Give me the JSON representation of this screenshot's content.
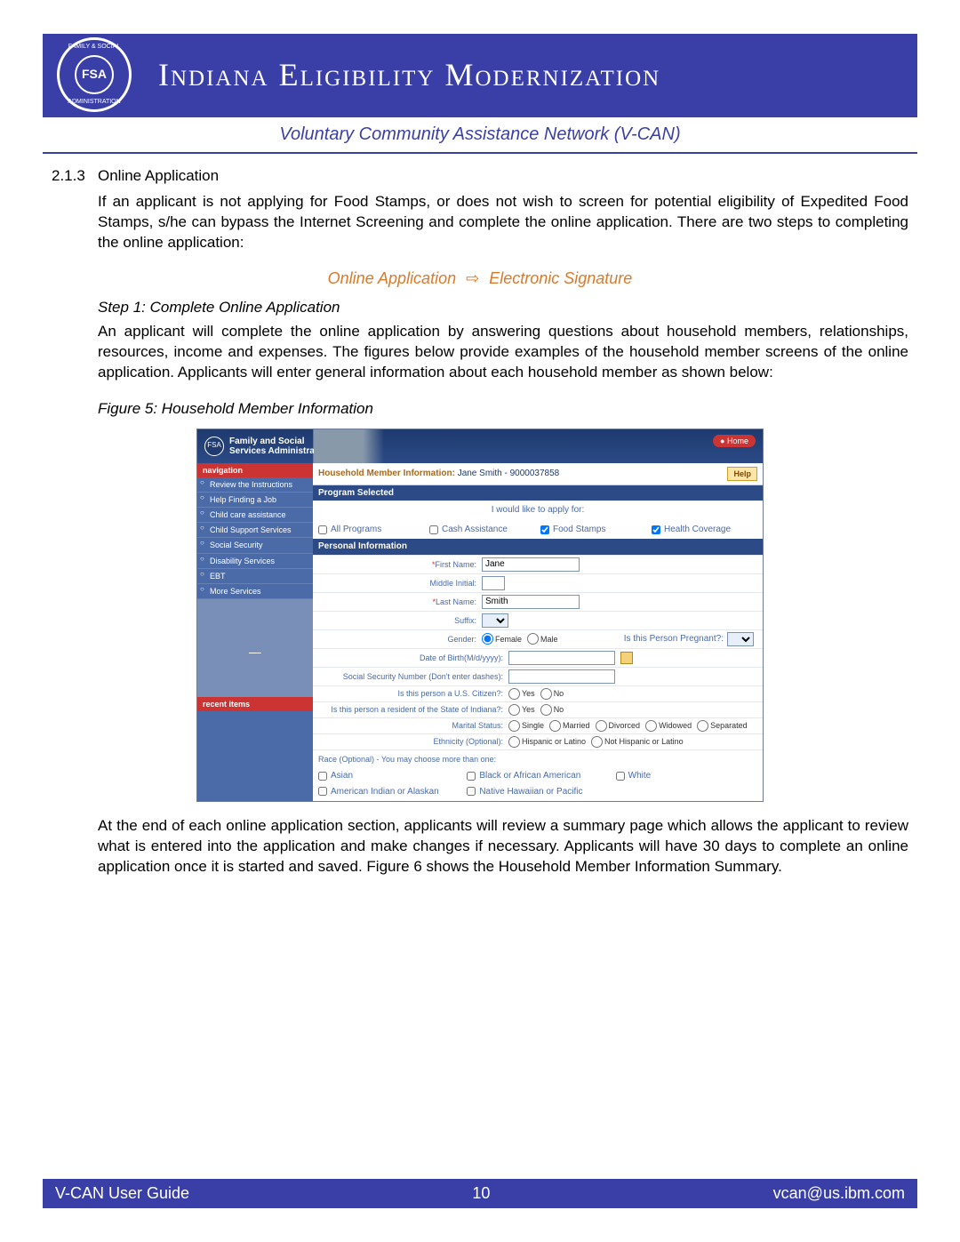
{
  "header": {
    "seal_abbr": "FSA",
    "seal_top": "FAMILY & SOCIAL",
    "seal_bottom": "ADMINISTRATION",
    "title": "Indiana Eligibility Modernization"
  },
  "subheader": "Voluntary Community Assistance Network (V-CAN)",
  "section": {
    "number": "2.1.3",
    "title": "Online Application",
    "intro": "If an applicant is not applying for Food Stamps, or does not wish to screen for potential eligibility of Expedited Food Stamps, s/he can bypass the Internet Screening and complete the online application. There are two steps to completing the online application:",
    "flow_left": "Online Application",
    "flow_arrow": "⇨",
    "flow_right": "Electronic Signature",
    "step1_head": "Step 1: Complete Online Application",
    "step1_body": "An applicant will complete the online application by answering questions about household members, relationships, resources, income and expenses. The figures below provide examples of the household member screens of the online application. Applicants will enter general information about each household member as shown below:",
    "fig_caption": "Figure 5: Household Member Information",
    "after_fig": "At the end of each online application section, applicants will review a summary page which allows the applicant to review what is entered into the application and make changes if necessary. Applicants will have 30 days to complete an online application once it is started and saved. Figure 6 shows the Household Member Information Summary."
  },
  "screenshot": {
    "banner_title": "Family and Social\nServices Administration",
    "home": "Home",
    "nav": {
      "head1": "navigation",
      "items": [
        "Review the Instructions",
        "Help Finding a Job",
        "Child care assistance",
        "Child Support Services",
        "Social Security",
        "Disability Services",
        "EBT",
        "More Services"
      ],
      "head2": "recent items"
    },
    "main_title_prefix": "Household Member Information:",
    "main_title_person": "Jane Smith - 9000037858",
    "help": "Help",
    "program_selected": "Program Selected",
    "apply_line": "I would like to apply for:",
    "programs": [
      "All Programs",
      "Cash Assistance",
      "Food Stamps",
      "Health Coverage"
    ],
    "programs_checked": [
      false,
      false,
      true,
      true
    ],
    "personal_info": "Personal Information",
    "fields": {
      "first_name_label": "First Name:",
      "first_name_value": "Jane",
      "middle_initial_label": "Middle Initial:",
      "last_name_label": "Last Name:",
      "last_name_value": "Smith",
      "suffix_label": "Suffix:",
      "gender_label": "Gender:",
      "gender_options": [
        "Female",
        "Male"
      ],
      "gender_selected": "Female",
      "pregnant_label": "Is this Person Pregnant?:",
      "dob_label": "Date of Birth(M/d/yyyy):",
      "ssn_label": "Social Security Number (Don't enter dashes):",
      "citizen_label": "Is this person a U.S. Citizen?:",
      "resident_label": "Is this person a resident of the State of Indiana?:",
      "yesno": [
        "Yes",
        "No"
      ],
      "marital_label": "Marital Status:",
      "marital_options": [
        "Single",
        "Married",
        "Divorced",
        "Widowed",
        "Separated"
      ],
      "ethnicity_label": "Ethnicity (Optional):",
      "ethnicity_options": [
        "Hispanic or Latino",
        "Not Hispanic or Latino"
      ],
      "race_header": "Race (Optional) - You may choose more than one:",
      "race_options_row1": [
        "Asian",
        "Black or African American",
        "White"
      ],
      "race_options_row2": [
        "American Indian or Alaskan",
        "Native Hawaiian or Pacific",
        ""
      ]
    }
  },
  "footer": {
    "left": "V-CAN User Guide",
    "center": "10",
    "right": "vcan@us.ibm.com"
  }
}
